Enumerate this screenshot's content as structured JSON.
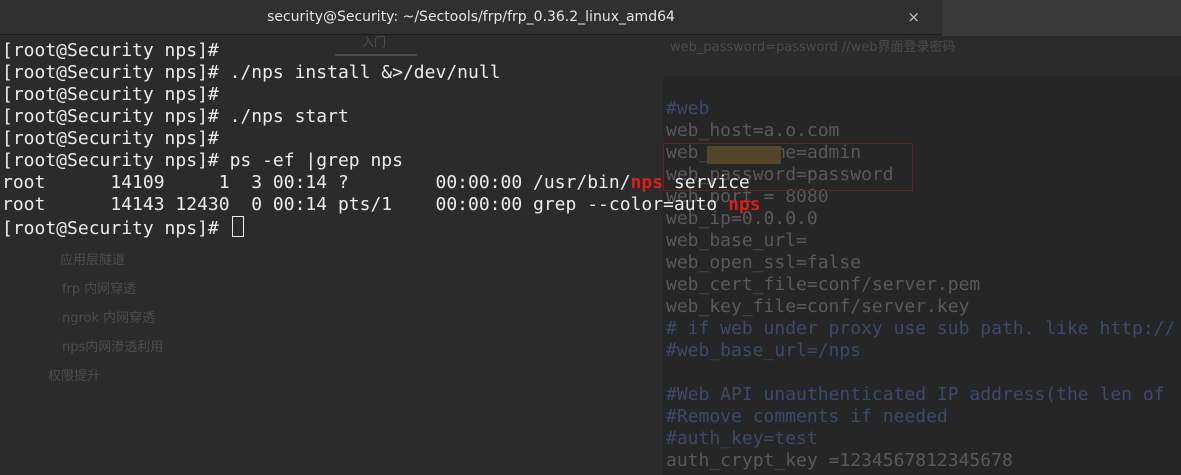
{
  "window": {
    "title": "security@Security: ~/Sectools/frp/frp_0.36.2_linux_amd64",
    "close_glyph": "×"
  },
  "terminal": {
    "prompt": "[root@Security nps]# ",
    "lines": [
      {
        "prompt": "[root@Security nps]#",
        "cmd": ""
      },
      {
        "prompt": "[root@Security nps]# ",
        "cmd": "./nps install &>/dev/null"
      },
      {
        "prompt": "[root@Security nps]#",
        "cmd": ""
      },
      {
        "prompt": "[root@Security nps]# ",
        "cmd": "./nps start"
      },
      {
        "prompt": "[root@Security nps]#",
        "cmd": ""
      },
      {
        "prompt": "[root@Security nps]# ",
        "cmd": "ps -ef |grep nps"
      }
    ],
    "ps_rows": [
      {
        "pre": "root      14109     1  3 00:14 ?        00:00:00 /usr/bin/",
        "match": "nps",
        "post": " service"
      },
      {
        "pre": "root      14143 12430  0 00:14 pts/1    00:00:00 grep --color=auto ",
        "match": "nps",
        "post": ""
      }
    ],
    "final_prompt": "[root@Security nps]# "
  },
  "background": {
    "tab_label": "入门",
    "top_right_text": "web_password=password    //web界面登录密码",
    "sidebar_items": [
      "应用层隧道",
      "frp 内网穿透",
      "ngrok 内网穿透",
      "nps内网渗透利用",
      "权限提升"
    ],
    "editor_lines": [
      {
        "text": "#web",
        "comment": true
      },
      {
        "text": "web_host=a.o.com",
        "comment": false
      },
      {
        "text": "web_username=admin",
        "comment": false
      },
      {
        "text": "web_password=password",
        "comment": false
      },
      {
        "text": "web_port = 8080",
        "comment": false
      },
      {
        "text": "web_ip=0.0.0.0",
        "comment": false
      },
      {
        "text": "web_base_url=",
        "comment": false
      },
      {
        "text": "web_open_ssl=false",
        "comment": false
      },
      {
        "text": "web_cert_file=conf/server.pem",
        "comment": false
      },
      {
        "text": "web_key_file=conf/server.key",
        "comment": false
      },
      {
        "text": "# if web under proxy use sub path. like http://",
        "comment": true
      },
      {
        "text": "#web_base_url=/nps",
        "comment": true
      },
      {
        "text": "",
        "comment": false
      },
      {
        "text": "#Web API unauthenticated IP address(the len of",
        "comment": true
      },
      {
        "text": "#Remove comments if needed",
        "comment": true
      },
      {
        "text": "#auth_key=test",
        "comment": true
      },
      {
        "text": "auth_crypt_key =1234567812345678",
        "comment": false
      }
    ]
  }
}
